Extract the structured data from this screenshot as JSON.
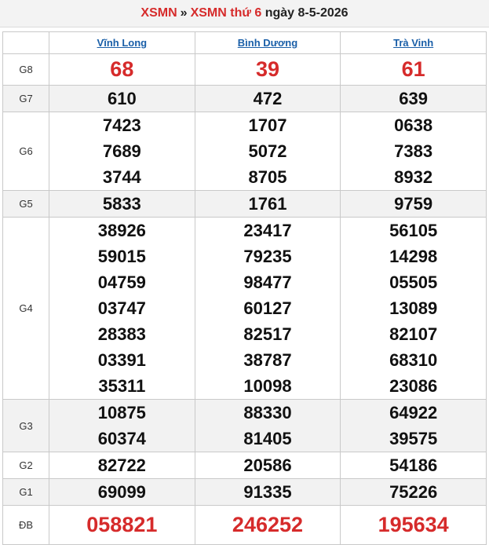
{
  "header": {
    "link1": "XSMN",
    "separator": "»",
    "link2": "XSMN thứ 6",
    "date_text": "ngày 8-5-2026"
  },
  "provinces": [
    "Vĩnh Long",
    "Bình Dương",
    "Trà Vinh"
  ],
  "prizes": {
    "g8": {
      "label": "G8",
      "values": [
        [
          "68"
        ],
        [
          "39"
        ],
        [
          "61"
        ]
      ]
    },
    "g7": {
      "label": "G7",
      "values": [
        [
          "610"
        ],
        [
          "472"
        ],
        [
          "639"
        ]
      ]
    },
    "g6": {
      "label": "G6",
      "values": [
        [
          "7423",
          "7689",
          "3744"
        ],
        [
          "1707",
          "5072",
          "8705"
        ],
        [
          "0638",
          "7383",
          "8932"
        ]
      ]
    },
    "g5": {
      "label": "G5",
      "values": [
        [
          "5833"
        ],
        [
          "1761"
        ],
        [
          "9759"
        ]
      ]
    },
    "g4": {
      "label": "G4",
      "values": [
        [
          "38926",
          "59015",
          "04759",
          "03747",
          "28383",
          "03391",
          "35311"
        ],
        [
          "23417",
          "79235",
          "98477",
          "60127",
          "82517",
          "38787",
          "10098"
        ],
        [
          "56105",
          "14298",
          "05505",
          "13089",
          "82107",
          "68310",
          "23086"
        ]
      ]
    },
    "g3": {
      "label": "G3",
      "values": [
        [
          "10875",
          "60374"
        ],
        [
          "88330",
          "81405"
        ],
        [
          "64922",
          "39575"
        ]
      ]
    },
    "g2": {
      "label": "G2",
      "values": [
        [
          "82722"
        ],
        [
          "20586"
        ],
        [
          "54186"
        ]
      ]
    },
    "g1": {
      "label": "G1",
      "values": [
        [
          "69099"
        ],
        [
          "91335"
        ],
        [
          "75226"
        ]
      ]
    },
    "db": {
      "label": "ĐB",
      "values": [
        [
          "058821"
        ],
        [
          "246252"
        ],
        [
          "195634"
        ]
      ]
    }
  },
  "colors": {
    "accent_red": "#d62b2b",
    "link_blue": "#1a5fa8",
    "alt_row": "#f2f2f2"
  }
}
